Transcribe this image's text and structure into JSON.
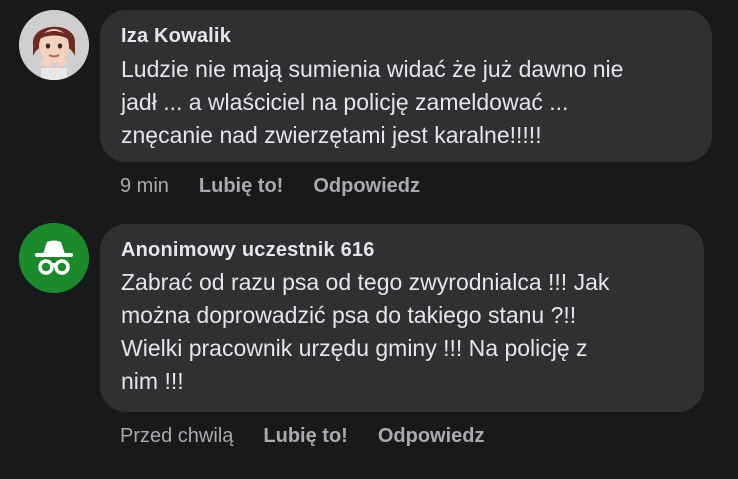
{
  "comments": [
    {
      "author": "Iza Kowalik",
      "avatar_icon": "memoji-avatar-icon",
      "text": "Ludzie nie mają sumienia widać że już dawno nie\njadł ... a wlaściciel na policję zameldować ...\nznęcanie nad zwierzętami jest karalne!!!!!",
      "time": "9 min",
      "like_label": "Lubię to!",
      "reply_label": "Odpowiedz"
    },
    {
      "author": "Anonimowy uczestnik 616",
      "avatar_icon": "anonymous-spy-icon",
      "avatar_color": "#1a8a2a",
      "text": "Zabrać od razu psa od tego zwyrodnialca !!! Jak\nmożna doprowadzić psa do takiego stanu ?!!\nWielki pracownik urzędu gminy !!! Na policję z\nnim !!!",
      "time": "Przed chwilą",
      "like_label": "Lubię to!",
      "reply_label": "Odpowiedz"
    }
  ]
}
